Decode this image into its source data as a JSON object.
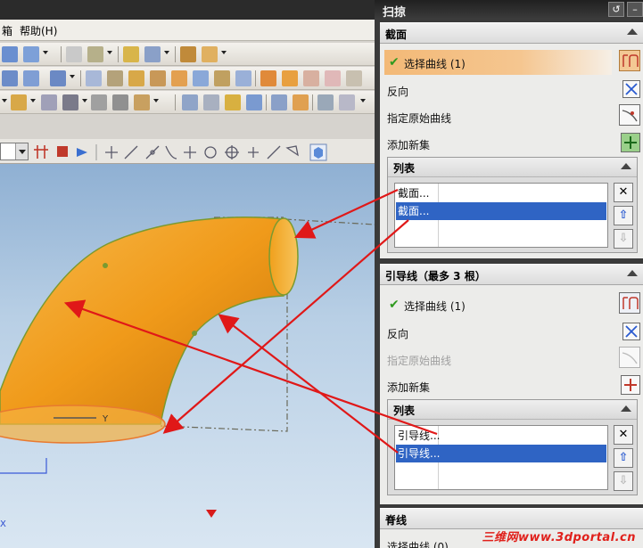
{
  "menubar": {
    "item1": "箱",
    "item2": "帮助(H)"
  },
  "dialog": {
    "title": "扫掠",
    "section_sections": {
      "label": "截面",
      "select_curve": "选择曲线 (1)",
      "reverse": "反向",
      "specify_origin": "指定原始曲线",
      "add_new_set": "添加新集",
      "list_label": "列表",
      "list_items": [
        "截面...",
        "截面..."
      ]
    },
    "section_guides": {
      "label": "引导线（最多 3 根）",
      "select_curve": "选择曲线 (1)",
      "reverse": "反向",
      "specify_origin": "指定原始曲线",
      "add_new_set": "添加新集",
      "list_label": "列表",
      "list_items": [
        "引导线...",
        "引导线..."
      ]
    },
    "section_spine": {
      "label": "脊线",
      "select_curve": "选择曲线 (0)"
    }
  },
  "viewport": {
    "axis_y": "Y",
    "axis_x": "X"
  },
  "watermark": "三维网www.3dportal.cn",
  "colors": {
    "accent_orange": "#f5a623",
    "arrow_red": "#e01818",
    "selection_blue": "#2f64c4"
  }
}
